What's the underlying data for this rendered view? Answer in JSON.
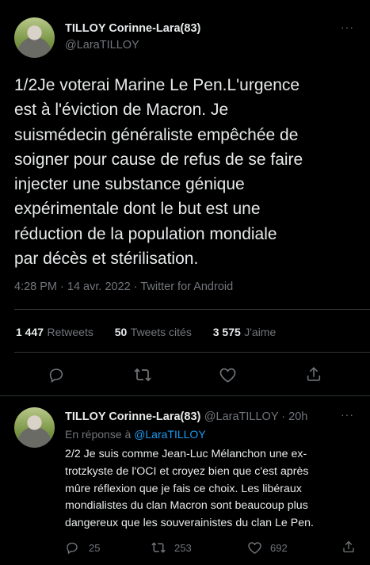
{
  "tweet": {
    "author_name": "TILLOY Corinne-Lara(83)",
    "author_handle": "@LaraTILLOY",
    "more": "···",
    "text_lines": [
      "1/2Je voterai Marine Le Pen.L'urgence",
      "est à l'éviction de Macron. Je",
      "suismédecin généraliste empêchée de",
      "soigner pour cause de refus de se faire",
      "injecter une substance génique",
      "expérimentale dont le but est une",
      "réduction de la population mondiale",
      "par décès et stérilisation."
    ],
    "meta": "4:28 PM · 14 avr. 2022 · Twitter for Android",
    "retweets_count": "1 447",
    "retweets_label": "Retweets",
    "quotes_count": "50",
    "quotes_label": "Tweets cités",
    "likes_count": "3 575",
    "likes_label": "J'aime"
  },
  "reply": {
    "author_name": "TILLOY Corinne-Lara(83)",
    "author_handle_time": "@LaraTILLOY · 20h",
    "more": "···",
    "in_reply_prefix": "En réponse à",
    "in_reply_handle": "@LaraTILLOY",
    "text_lines": [
      "2/2 Je suis comme Jean-Luc Mélanchon une ex-",
      "trotzkyste de l'OCI et croyez bien que c'est après",
      "mûre réflexion que je fais ce choix. Les libéraux",
      "mondialistes du clan Macron sont beaucoup plus",
      "dangereux que les souverainistes du clan Le Pen."
    ],
    "reply_count": "25",
    "retweet_count": "253",
    "like_count": "692"
  },
  "icons": {
    "reply": "reply-icon",
    "retweet": "retweet-icon",
    "like": "heart-icon",
    "share": "share-icon",
    "more": "more-icon"
  },
  "colors": {
    "background": "#000000",
    "text": "#e7e9ea",
    "secondary": "#71767b",
    "link": "#1d9bf0",
    "divider": "#2f3336"
  }
}
